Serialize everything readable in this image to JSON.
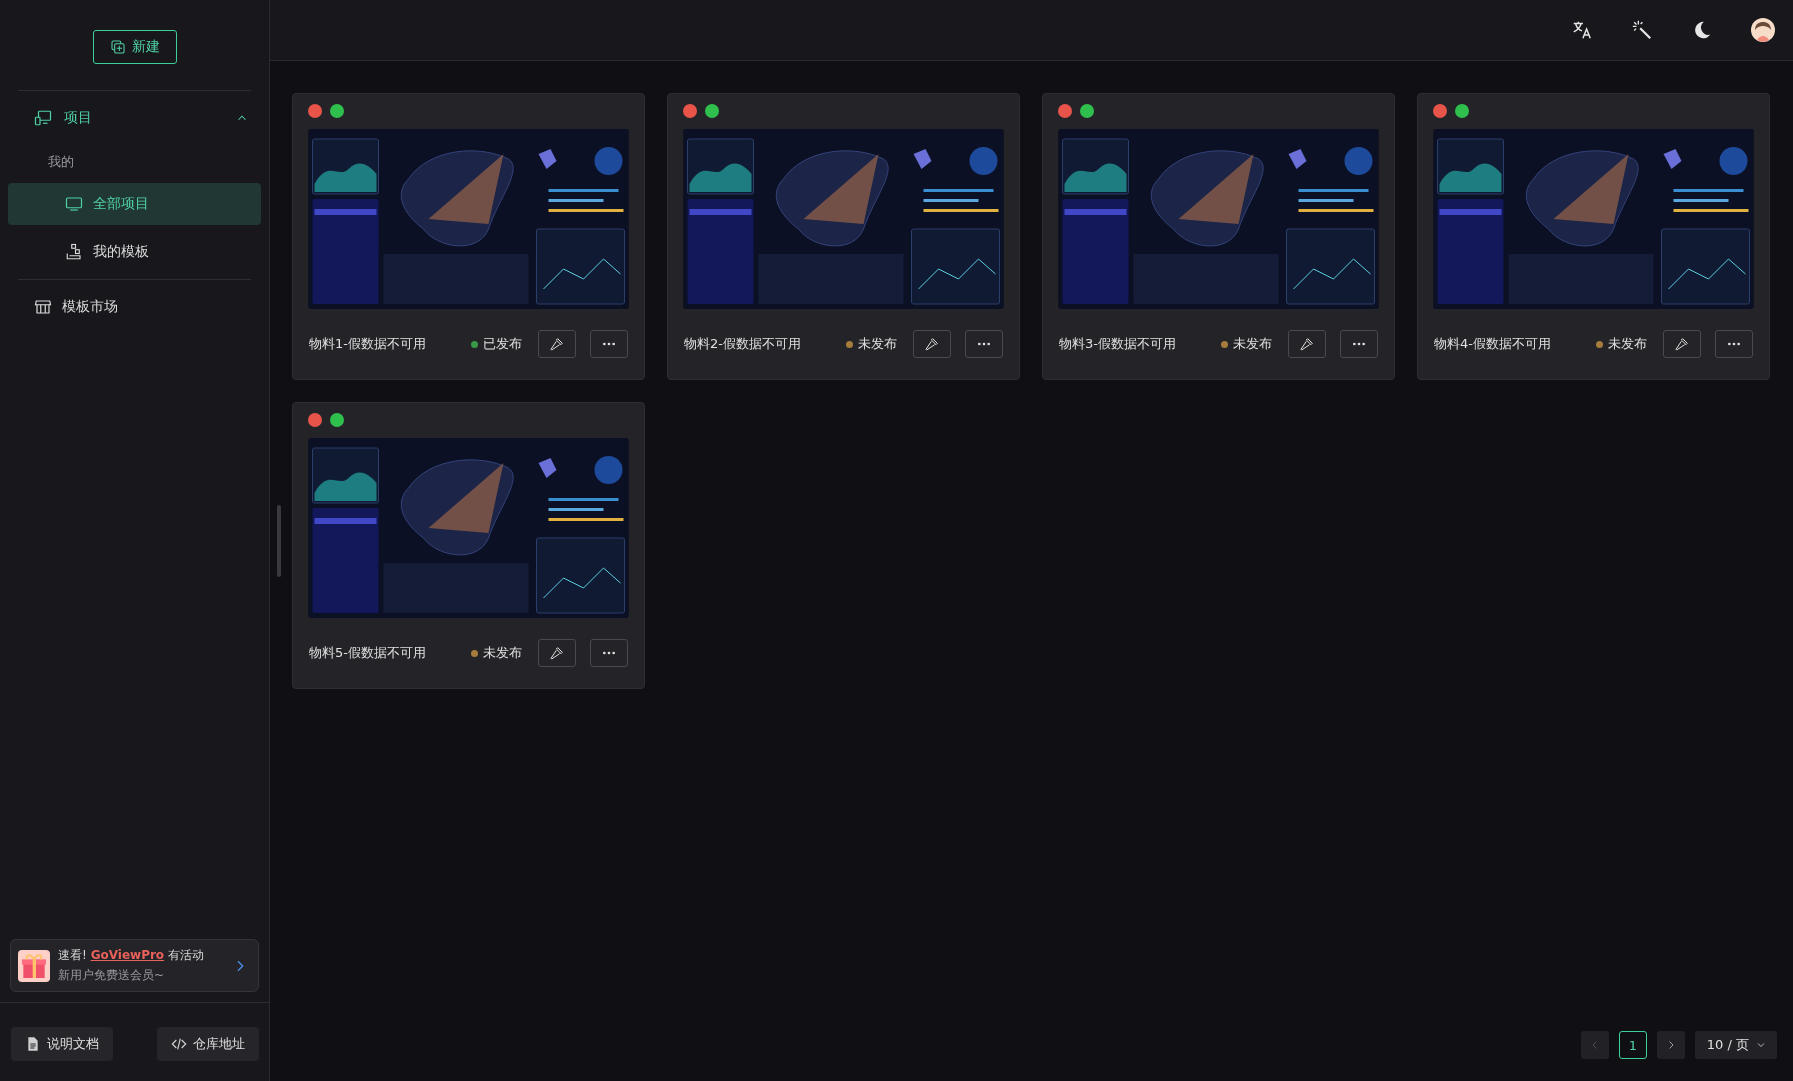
{
  "sidebar": {
    "new_button": "新建",
    "menu": [
      {
        "kind": "group",
        "label": "项目",
        "expanded": true,
        "children": [
          {
            "kind": "heading",
            "label": "我的"
          },
          {
            "kind": "item",
            "label": "全部项目",
            "selected": true
          },
          {
            "kind": "item",
            "label": "我的模板",
            "selected": false
          }
        ]
      },
      {
        "kind": "link",
        "label": "模板市场",
        "selected": false
      }
    ],
    "promo": {
      "lead": "速看!",
      "link": "GoViewPro",
      "tail": "有活动",
      "subtitle": "新用户免费送会员~"
    },
    "footer_buttons": [
      {
        "label": "说明文档"
      },
      {
        "label": "仓库地址"
      }
    ]
  },
  "projects": [
    {
      "title": "物料1-假数据不可用",
      "status": "已发布",
      "published": true
    },
    {
      "title": "物料2-假数据不可用",
      "status": "未发布",
      "published": false
    },
    {
      "title": "物料3-假数据不可用",
      "status": "未发布",
      "published": false
    },
    {
      "title": "物料4-假数据不可用",
      "status": "未发布",
      "published": false
    },
    {
      "title": "物料5-假数据不可用",
      "status": "未发布",
      "published": false
    }
  ],
  "pagination": {
    "prev_disabled": true,
    "pages": [
      {
        "label": "1",
        "selected": true
      }
    ],
    "page_size": "10 / 页"
  }
}
